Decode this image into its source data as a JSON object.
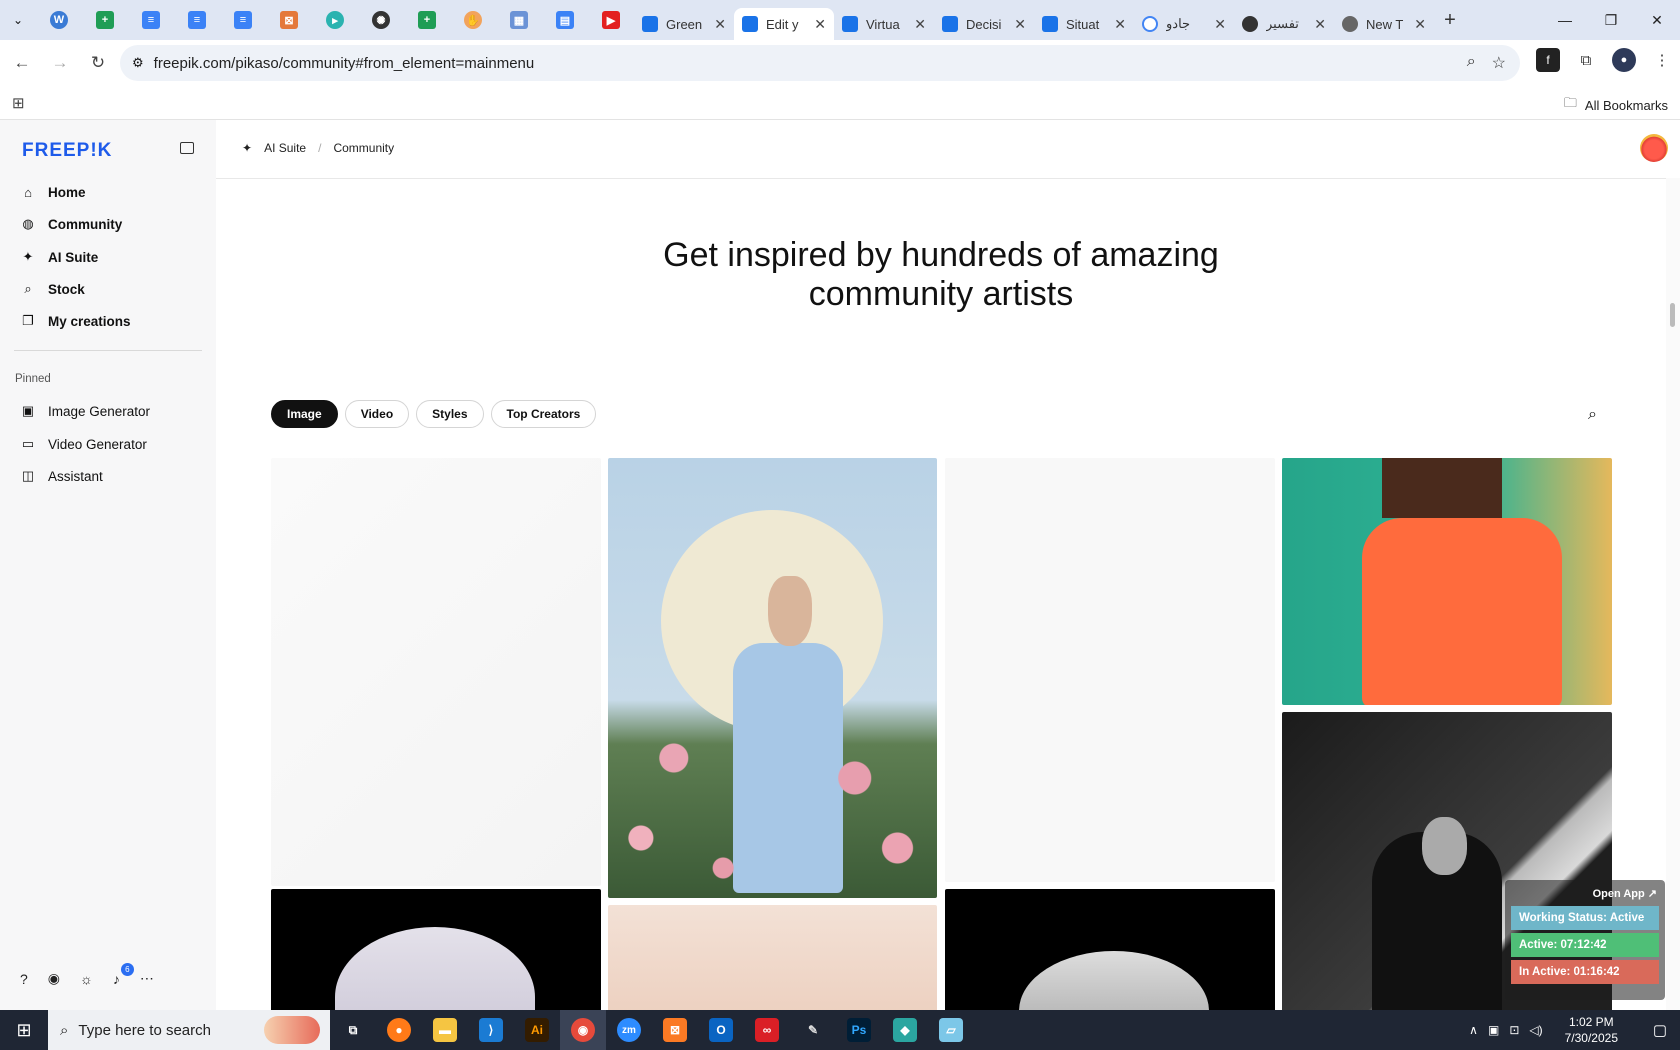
{
  "browser": {
    "tabs": [
      {
        "label": "Green",
        "icon": "docs-icon"
      },
      {
        "label": "Edit y",
        "icon": "docs-icon",
        "active": true
      },
      {
        "label": "Virtua",
        "icon": "docs-icon"
      },
      {
        "label": "Decisi",
        "icon": "docs-icon"
      },
      {
        "label": "Situat",
        "icon": "docs-icon"
      },
      {
        "label": "جادو",
        "icon": "google-icon"
      },
      {
        "label": "تفسير",
        "icon": "site-icon"
      },
      {
        "label": "New T",
        "icon": "chrome-icon"
      }
    ],
    "url": "freepik.com/pikaso/community#from_element=mainmenu",
    "bookmarks_label": "All Bookmarks"
  },
  "sidebar": {
    "logo": "FREEP!K",
    "nav": [
      {
        "label": "Home",
        "icon": "home-icon"
      },
      {
        "label": "Community",
        "icon": "globe-icon"
      },
      {
        "label": "AI Suite",
        "icon": "sparkle-icon"
      },
      {
        "label": "Stock",
        "icon": "search-icon"
      },
      {
        "label": "My creations",
        "icon": "stack-icon"
      }
    ],
    "pinned_label": "Pinned",
    "pinned": [
      {
        "label": "Image Generator",
        "icon": "image-icon"
      },
      {
        "label": "Video Generator",
        "icon": "video-icon"
      },
      {
        "label": "Assistant",
        "icon": "chat-icon"
      }
    ],
    "notifications_count": "6"
  },
  "header": {
    "breadcrumb": [
      "AI Suite",
      "Community"
    ]
  },
  "main": {
    "hero_line1": "Get inspired by hundreds of amazing",
    "hero_line2": "community artists",
    "filters": [
      "Image",
      "Video",
      "Styles",
      "Top Creators"
    ],
    "active_filter": "Image"
  },
  "widget": {
    "open_app": "Open App ↗",
    "working_status": "Working Status: Active",
    "active": "Active: 07:12:42",
    "inactive": "In Active: 01:16:42"
  },
  "taskbar": {
    "search_placeholder": "Type here to search",
    "time": "1:02 PM",
    "date": "7/30/2025"
  }
}
